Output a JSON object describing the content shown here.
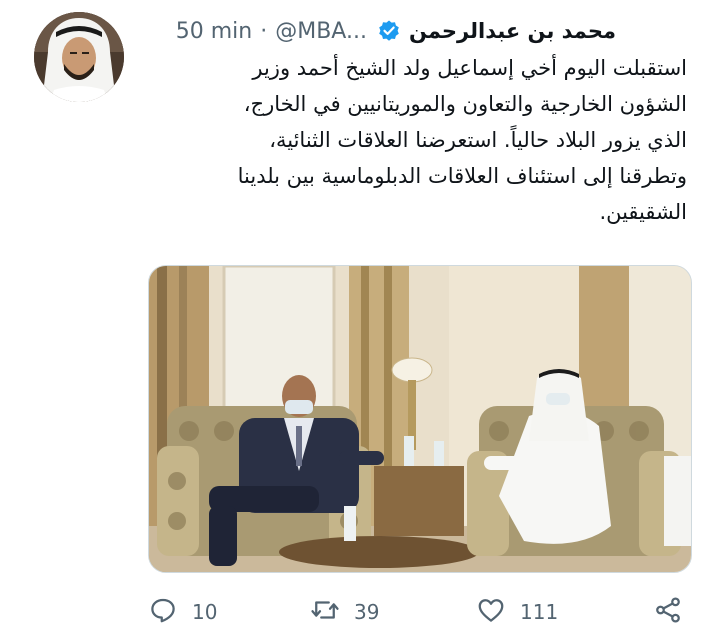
{
  "author": {
    "name": "محمد بن عبدالرحمن",
    "handle": "@MBA...",
    "separator": "·",
    "time": "50 min",
    "verified": true
  },
  "tweet": {
    "lines": [
      "استقبلت اليوم أخي إسماعيل ولد الشيخ أحمد وزير",
      "الشؤون الخارجية والتعاون والموريتانيين في الخارج،",
      "الذي يزور البلاد حالياً. استعرضنا العلاقات الثنائية،",
      "وتطرقنا إلى استئناف العلاقات الدبلوماسية بين بلدينا",
      "الشقيقين."
    ]
  },
  "actions": {
    "replies": "10",
    "retweets": "39",
    "likes": "111"
  },
  "icons": {
    "reply": "reply-icon",
    "retweet": "retweet-icon",
    "like": "heart-icon",
    "share": "share-icon",
    "verified": "verified-badge-icon"
  },
  "colors": {
    "text": "#0f1419",
    "secondary": "#536471",
    "verified": "#1d9bf0"
  }
}
